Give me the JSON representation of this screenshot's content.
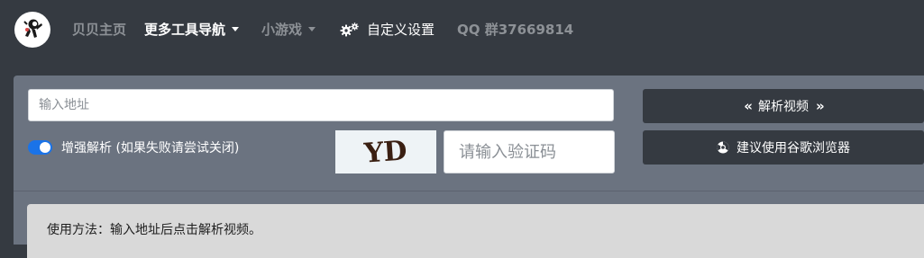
{
  "nav": {
    "logo_icon": "astronaut-logo-icon",
    "home": "贝贝主页",
    "tools": "更多工具导航",
    "games": "小游戏",
    "settings": "自定义设置",
    "qq": "QQ 群37669814"
  },
  "form": {
    "url_placeholder": "输入地址",
    "toggle_label": "增强解析 (如果失败请尝试关闭)",
    "toggle_on": true,
    "captcha_text": "YD",
    "captcha_placeholder": "请输入验证码"
  },
  "buttons": {
    "parse_left": "«",
    "parse_label": "解析视频",
    "parse_right": "»",
    "browser_label": "建议使用谷歌浏览器"
  },
  "usage": {
    "text": "使用方法：输入地址后点击解析视频。"
  },
  "colors": {
    "background": "#353a41",
    "panel": "#6b7380",
    "toggle_accent": "#1a73e8",
    "usage_bg": "#d9d9d9"
  }
}
